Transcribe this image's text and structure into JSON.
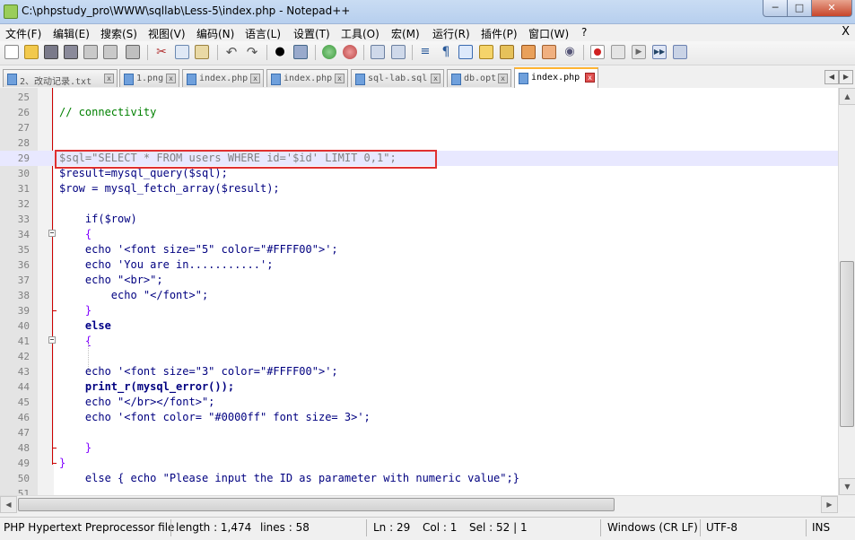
{
  "window": {
    "title": "C:\\phpstudy_pro\\WWW\\sqllab\\Less-5\\index.php - Notepad++"
  },
  "menu": [
    "文件(F)",
    "编辑(E)",
    "搜索(S)",
    "视图(V)",
    "编码(N)",
    "语言(L)",
    "设置(T)",
    "工具(O)",
    "宏(M)",
    "运行(R)",
    "插件(P)",
    "窗口(W)",
    "?"
  ],
  "menu_close": "X",
  "tabs": [
    {
      "label": "2、改动记录.txt"
    },
    {
      "label": "1.png"
    },
    {
      "label": "index.php"
    },
    {
      "label": "index.php"
    },
    {
      "label": "sql-lab.sql"
    },
    {
      "label": "db.opt"
    },
    {
      "label": "index.php",
      "active": true
    }
  ],
  "editor": {
    "lines": [
      {
        "n": "25",
        "code": ""
      },
      {
        "n": "26",
        "code": "// connectivity"
      },
      {
        "n": "27",
        "code": ""
      },
      {
        "n": "28",
        "code": ""
      },
      {
        "n": "29",
        "code": "$sql=\"SELECT * FROM users WHERE id='$id' LIMIT 0,1\";"
      },
      {
        "n": "30",
        "code": "$result=mysql_query($sql);"
      },
      {
        "n": "31",
        "code": "$row = mysql_fetch_array($result);"
      },
      {
        "n": "32",
        "code": ""
      },
      {
        "n": "33",
        "code": "    if($row)"
      },
      {
        "n": "34",
        "code": "    {"
      },
      {
        "n": "35",
        "code": "    echo '<font size=\"5\" color=\"#FFFF00\">';"
      },
      {
        "n": "36",
        "code": "    echo 'You are in...........';"
      },
      {
        "n": "37",
        "code": "    echo \"<br>\";"
      },
      {
        "n": "38",
        "code": "        echo \"</font>\";"
      },
      {
        "n": "39",
        "code": "    }"
      },
      {
        "n": "40",
        "code": "    else"
      },
      {
        "n": "41",
        "code": "    {"
      },
      {
        "n": "42",
        "code": ""
      },
      {
        "n": "43",
        "code": "    echo '<font size=\"3\" color=\"#FFFF00\">';"
      },
      {
        "n": "44",
        "code": "    print_r(mysql_error());"
      },
      {
        "n": "45",
        "code": "    echo \"</br></font>\";"
      },
      {
        "n": "46",
        "code": "    echo '<font color= \"#0000ff\" font size= 3>';"
      },
      {
        "n": "47",
        "code": ""
      },
      {
        "n": "48",
        "code": "    }"
      },
      {
        "n": "49",
        "code": "}"
      },
      {
        "n": "50",
        "code": "    else { echo \"Please input the ID as parameter with numeric value\";}"
      },
      {
        "n": "51",
        "code": ""
      }
    ],
    "current_line": "29"
  },
  "status": {
    "language": "PHP Hypertext Preprocessor file",
    "length": "length : 1,474",
    "lines": "lines : 58",
    "ln": "Ln : 29",
    "col": "Col : 1",
    "sel": "Sel : 52 | 1",
    "eol": "Windows (CR LF)",
    "encoding": "UTF-8",
    "mode": "INS"
  },
  "colors": {
    "keyword": "#000088",
    "string": "#808080",
    "comment": "#008000",
    "operator": "#8000ff",
    "highlight_box": "#e03030",
    "current_line": "#e8e8ff",
    "active_tab_accent": "#ffb432"
  },
  "toolbar_icons": [
    "new-file-icon",
    "open-file-icon",
    "save-icon",
    "save-all-icon",
    "close-icon",
    "close-all-icon",
    "print-icon",
    "cut-icon",
    "copy-icon",
    "paste-icon",
    "undo-icon",
    "redo-icon",
    "find-icon",
    "replace-icon",
    "zoom-in-icon",
    "zoom-out-icon",
    "sync-v-icon",
    "sync-h-icon",
    "wrap-icon",
    "show-all-chars-icon",
    "indent-guide-icon",
    "folder-icon",
    "map-icon",
    "function-list-icon",
    "explorer-icon",
    "monitor-icon",
    "record-macro-icon",
    "stop-macro-icon",
    "play-macro-icon",
    "run-macro-multiple-icon",
    "save-macro-icon"
  ]
}
